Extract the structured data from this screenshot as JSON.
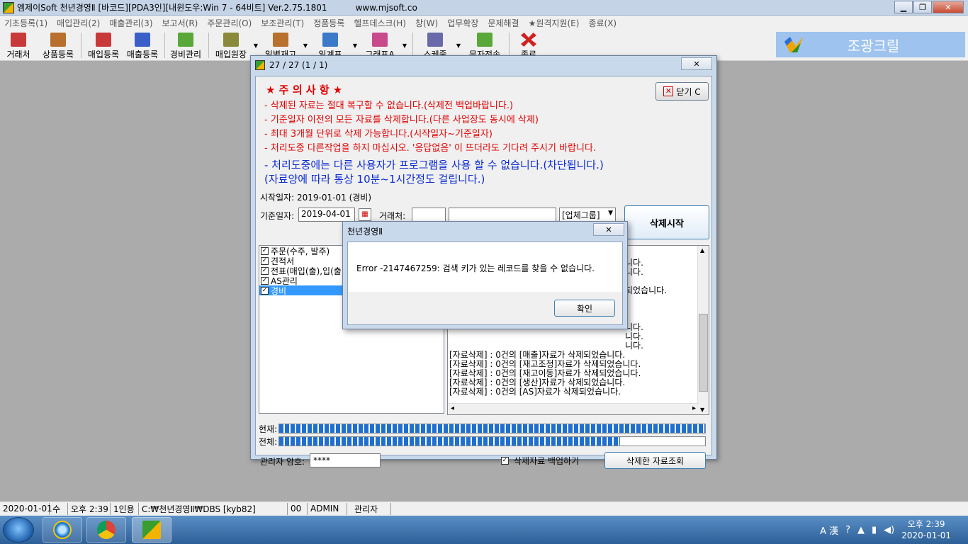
{
  "window": {
    "title": "엠제이Soft 천년경영Ⅱ [바코드][PDA3인][내윈도우:Win 7 - 64비트] Ver.2.75.1801",
    "site": "www.mjsoft.co",
    "minimize": "▁",
    "restore": "❐",
    "close": "✕"
  },
  "menu": [
    "기초등록(1)",
    "매입관리(2)",
    "매출관리(3)",
    "보고서(R)",
    "주문관리(O)",
    "보조관리(T)",
    "정품등록",
    "헬프데스크(H)",
    "창(W)",
    "업무확장",
    "문제해결",
    "★원격지원(E)",
    "종료(X)"
  ],
  "toolbar": {
    "items": [
      {
        "label": "거래처",
        "color": "#c83a3a"
      },
      {
        "label": "상품등록",
        "color": "#b8702c"
      },
      {
        "label": "매입등록",
        "color": "#c83a3a"
      },
      {
        "label": "매출등록",
        "color": "#3a5fc8"
      },
      {
        "label": "경비관리",
        "color": "#5aa83a"
      },
      {
        "label": "매입원장",
        "color": "#8a8a3a"
      },
      {
        "label": "일별재고",
        "color": "#b8702c"
      },
      {
        "label": "일계표",
        "color": "#3a7ac8"
      },
      {
        "label": "그래프A",
        "color": "#c84a8a"
      },
      {
        "label": "스케줄",
        "color": "#6a6aaa"
      },
      {
        "label": "문자전송",
        "color": "#5aa83a"
      },
      {
        "label": "종료",
        "color": "#d02020"
      }
    ],
    "arrow": "▼"
  },
  "brand": {
    "name": "조광크릴"
  },
  "dialog": {
    "title": "27 / 27 (1 / 1)",
    "close_x": "✕",
    "notice_header": "★ 주 의 사 항 ★",
    "notices": [
      "- 삭제된 자료는 절대 복구할 수 없습니다.(삭제전 백업바랍니다.)",
      "- 기준일자 이전의 모든 자료를 삭제합니다.(다른 사업장도 동시에 삭제)",
      "- 최대 3개월 단위로 삭제 가능합니다.(시작일자~기준일자)",
      "- 처리도중 다른작업을 하지 마십시오. '응답없음' 이 뜨더라도 기다려 주시기 바랍니다."
    ],
    "warning_lines": [
      "- 처리도중에는 다른 사용자가 프로그램을 사용 할 수 없습니다.(차단됩니다.)",
      "  (자료양에 따라 통상 10분~1시간정도 걸립니다.)"
    ],
    "close_button": "닫기 C",
    "close_icon": "✕",
    "start_date_label": "시작일자:  2019-01-01 (경비)",
    "base_date_label": "기준일자:",
    "base_date_value": "2019-04-01",
    "calendar_icon": "calendar-icon",
    "partner_label": "거래처:",
    "partner_code": "",
    "partner_name": "",
    "group_combo": "[업체그룹]",
    "combo_arrow": "▼",
    "start_button": "삭제시작",
    "checklist": [
      {
        "label": "주문(수주, 발주)",
        "checked": true,
        "selected": false
      },
      {
        "label": "견적서",
        "checked": true,
        "selected": false
      },
      {
        "label": "전표(매입(출),입(출",
        "checked": true,
        "selected": false
      },
      {
        "label": "AS관리",
        "checked": true,
        "selected": false
      },
      {
        "label": "경비",
        "checked": true,
        "selected": true
      }
    ],
    "check_mark": "✓",
    "log_lines_top": [
      "니다.",
      "니다.",
      "되었습니다."
    ],
    "log_lines_mid": [
      "니다.",
      "니다.",
      "니다."
    ],
    "log_lines": [
      "[자료삭제] : 0건의 [매출]자료가 삭제되었습니다.",
      "[자료삭제] : 0건의 [재고조정]자료가 삭제되었습니다.",
      "[자료삭제] : 0건의 [재고이동]자료가 삭제되었습니다.",
      "[자료삭제] : 0건의 [생산]자료가 삭제되었습니다.",
      "[자료삭제] : 0건의 [AS]자료가 삭제되었습니다."
    ],
    "scroll_up": "▲",
    "scroll_down": "▼",
    "scroll_left": "◂",
    "scroll_right": "▸",
    "progress_current_label": "현재:",
    "progress_current": 1.0,
    "progress_total_label": "전체:",
    "progress_total": 0.8,
    "admin_pw_label": "관리자 암호:",
    "admin_pw_value": "****",
    "backup_label": "삭제자료 백업하기",
    "backup_checked": true,
    "view_button": "삭제한 자료조회"
  },
  "error_dialog": {
    "title": "천년경영Ⅱ",
    "close_x": "✕",
    "message": "Error -2147467259: 검색 키가 있는 레코드를 찾을 수 없습니다.",
    "ok_button": "확인"
  },
  "statusbar": [
    "2020-01-01",
    "수",
    "오후 2:39",
    "1인용",
    "C:₩천년경영Ⅱ₩DBS [kyb82]",
    "00",
    "ADMIN",
    "관리자"
  ],
  "taskbar": {
    "tray_text": "A 漢",
    "clock_time": "오후 2:39",
    "clock_date": "2020-01-01"
  }
}
